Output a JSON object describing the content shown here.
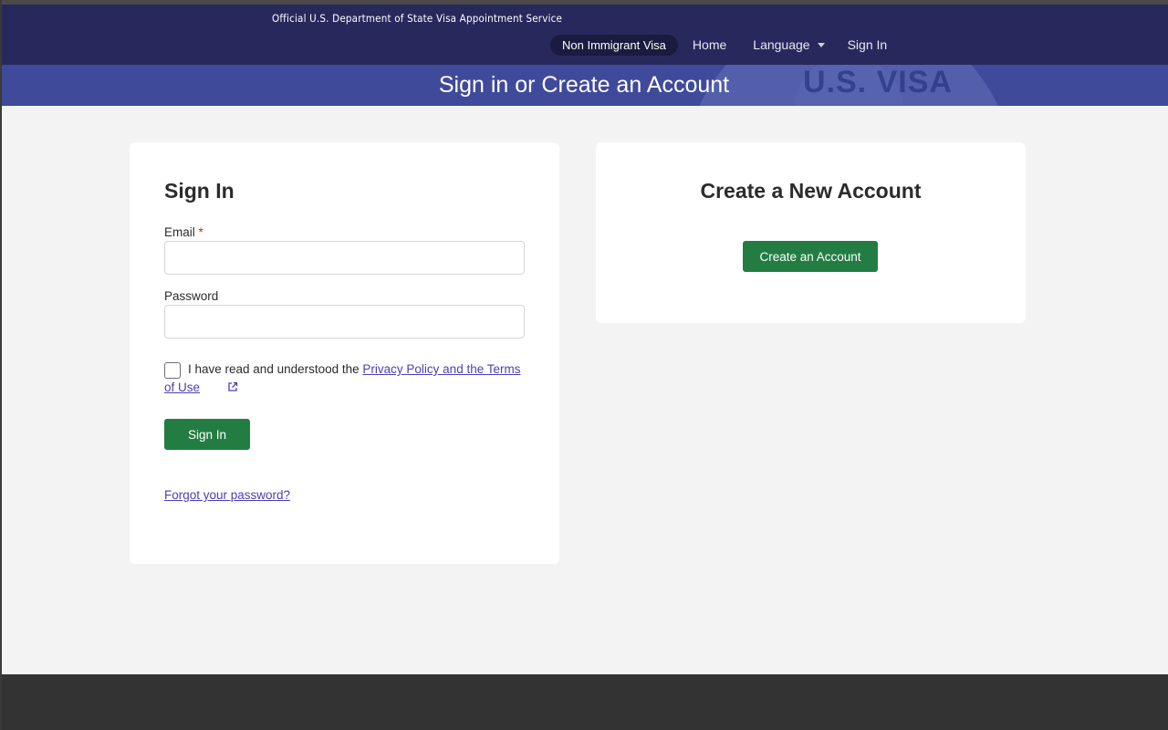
{
  "header": {
    "official_text": "Official U.S. Department of State Visa Appointment Service",
    "nav": {
      "active_pill": "Non Immigrant Visa",
      "home": "Home",
      "language": "Language",
      "sign_in": "Sign In"
    }
  },
  "banner": {
    "title": "Sign in or Create an Account",
    "seal_text": "U.S. VISA"
  },
  "sign_in_card": {
    "heading": "Sign In",
    "email_label": "Email",
    "required_mark": "*",
    "email_value": "",
    "password_label": "Password",
    "password_value": "",
    "consent_prefix": "I have read and understood the ",
    "consent_link": "Privacy Policy and the Terms of Use",
    "consent_checked": false,
    "submit_label": "Sign In",
    "forgot_link": "Forgot your password?"
  },
  "create_card": {
    "heading": "Create a New Account",
    "button_label": "Create an Account"
  },
  "colors": {
    "header_bg": "#27285c",
    "banner_bg": "#3f4a9a",
    "button_green": "#237d43",
    "link": "#4b3fb4",
    "footer_bg": "#333333"
  }
}
